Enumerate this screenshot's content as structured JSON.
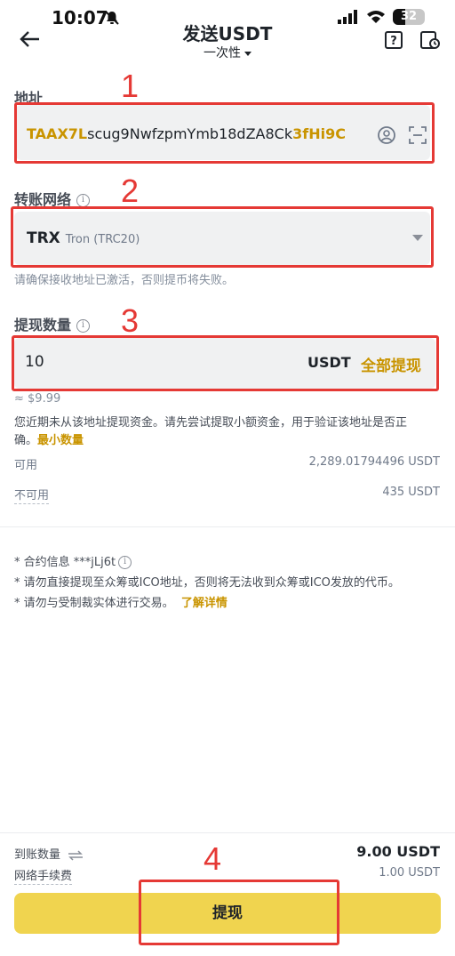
{
  "status_bar": {
    "time": "10:07",
    "battery": "32"
  },
  "header": {
    "title": "发送USDT",
    "subtitle": "一次性"
  },
  "address": {
    "label": "地址",
    "value_prefix": "TAAX7L",
    "value_middle": "scug9NwfzpmYmb18dZA8Ck",
    "value_suffix": "3fHi9C"
  },
  "network": {
    "label": "转账网络",
    "selected": "TRX",
    "selected_detail": "Tron (TRC20)",
    "hint": "请确保接收地址已激活，否则提币将失败。"
  },
  "amount": {
    "label": "提现数量",
    "value": "10",
    "unit": "USDT",
    "max_label": "全部提现",
    "approx": "≈ $9.99",
    "warning": "您近期未从该地址提现资金。请先尝试提取小额资金，用于验证该地址是否正确。",
    "warning_link": "最小数量"
  },
  "balances": {
    "available_label": "可用",
    "available_value": "2,289.01794496 USDT",
    "unavailable_label": "不可用",
    "unavailable_value": "435 USDT"
  },
  "notes": {
    "contract": "* 合约信息 ***jLj6t",
    "ico": "* 请勿直接提现至众筹或ICO地址，否则将无法收到众筹或ICO发放的代币。",
    "sanction": "* 请勿与受制裁实体进行交易。",
    "learn_more": "了解详情"
  },
  "footer": {
    "receive_label": "到账数量",
    "receive_value": "9.00 USDT",
    "fee_label": "网络手续费",
    "fee_value": "1.00 USDT",
    "submit_label": "提现"
  },
  "annotations": {
    "n1": "1",
    "n2": "2",
    "n3": "3",
    "n4": "4"
  },
  "colors": {
    "accent": "#c99400",
    "button": "#f0d44f",
    "annotation": "#e53935"
  }
}
